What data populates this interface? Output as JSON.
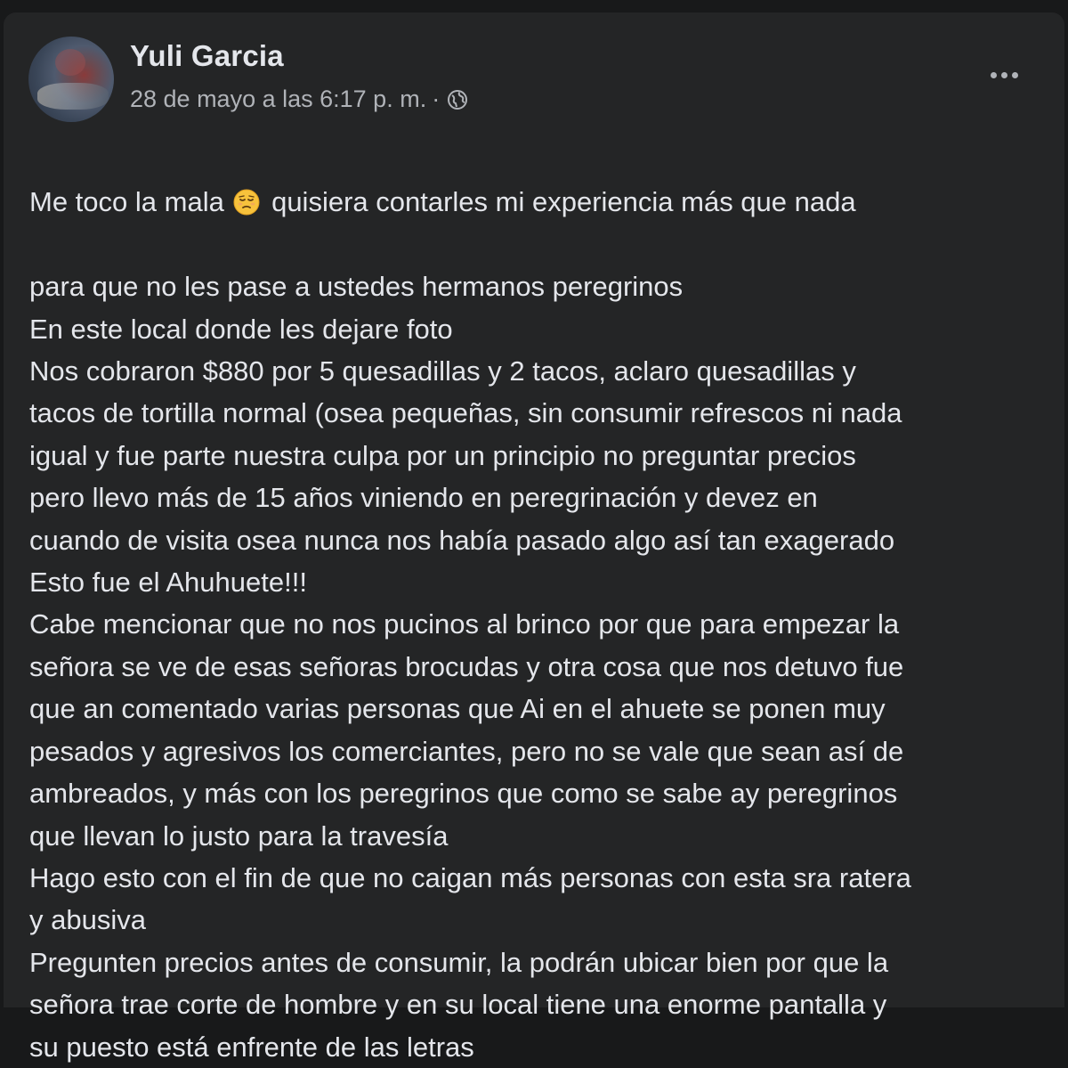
{
  "post": {
    "author": "Yuli Garcia",
    "timestamp": "28 de mayo a las 6:17 p. m.",
    "separator": "·",
    "privacy_icon": "globe-icon",
    "more_icon": "more-options-icon",
    "emoji_icon": "disappointed-face-emoji",
    "colors": {
      "card_background": "#242526",
      "page_background": "#18191a",
      "text_primary": "#e4e6eb",
      "text_secondary": "#b0b3b8"
    },
    "first_line": {
      "before_emoji": "Me toco la mala",
      "after_emoji": "quisiera contarles mi experiencia más que nada"
    },
    "lines": [
      "para que no les pase a ustedes hermanos peregrinos",
      "En este local donde les dejare foto",
      "Nos cobraron $880 por 5 quesadillas y 2 tacos, aclaro quesadillas y",
      "tacos de tortilla normal (osea pequeñas, sin consumir refrescos ni nada",
      "igual y fue parte nuestra culpa por un principio no preguntar precios",
      "pero llevo más de 15 años viniendo en peregrinación y devez en",
      "cuando de visita osea nunca nos había pasado algo así tan exagerado",
      "Esto fue el Ahuhuete!!!",
      "Cabe mencionar que no nos pucinos al brinco por que para empezar la",
      "señora se ve de esas señoras brocudas y otra cosa que nos detuvo fue",
      "que an comentado varias personas que Ai en el ahuete se ponen muy",
      "pesados y agresivos los comerciantes, pero no se vale que sean así de",
      "ambreados, y más con los peregrinos que como se sabe ay peregrinos",
      "que llevan lo justo para la travesía",
      "Hago esto con el fin de que no caigan más personas con esta sra ratera",
      "y abusiva",
      "Pregunten precios antes de consumir, la podrán ubicar bien por que la",
      "señora trae corte de hombre y en su local tiene una enorme pantalla y",
      "su puesto está enfrente de las letras"
    ]
  }
}
